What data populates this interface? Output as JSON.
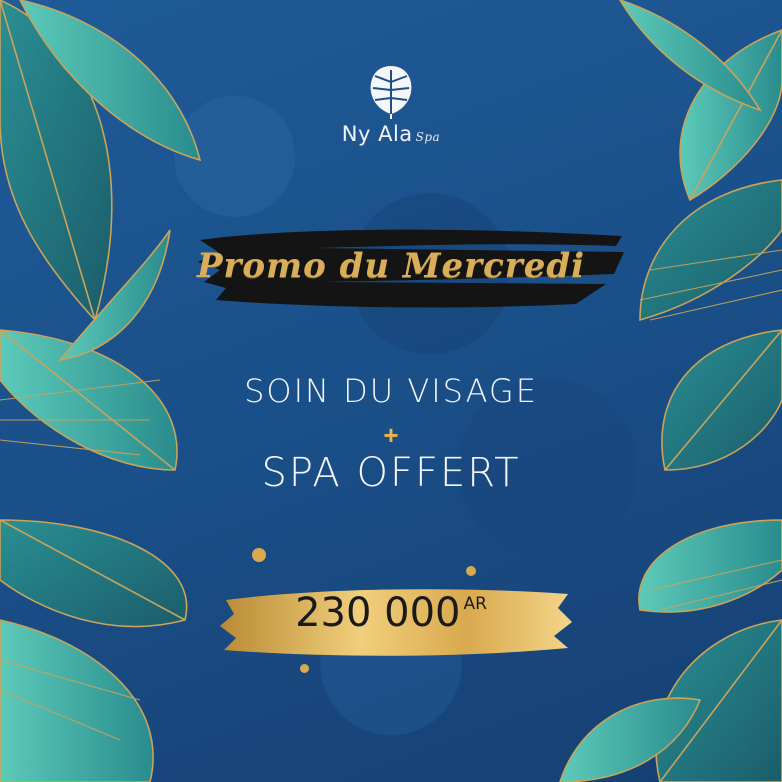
{
  "brand": {
    "name": "Ny Ala",
    "suffix": "Spa",
    "logo_icon": "monstera-leaf-icon"
  },
  "promo": {
    "title": "Promo du Mercredi"
  },
  "offer": {
    "line1": "SOIN DU VISAGE",
    "separator": "+",
    "line2": "SPA OFFERT"
  },
  "price": {
    "amount": "230 000",
    "currency": "AR"
  },
  "colors": {
    "background": "#1c4f86",
    "gold": "#d9ae5a",
    "leaf_teal": "#3fb3aa",
    "leaf_dark": "#1b4c5a",
    "text": "#f3f5f7"
  }
}
